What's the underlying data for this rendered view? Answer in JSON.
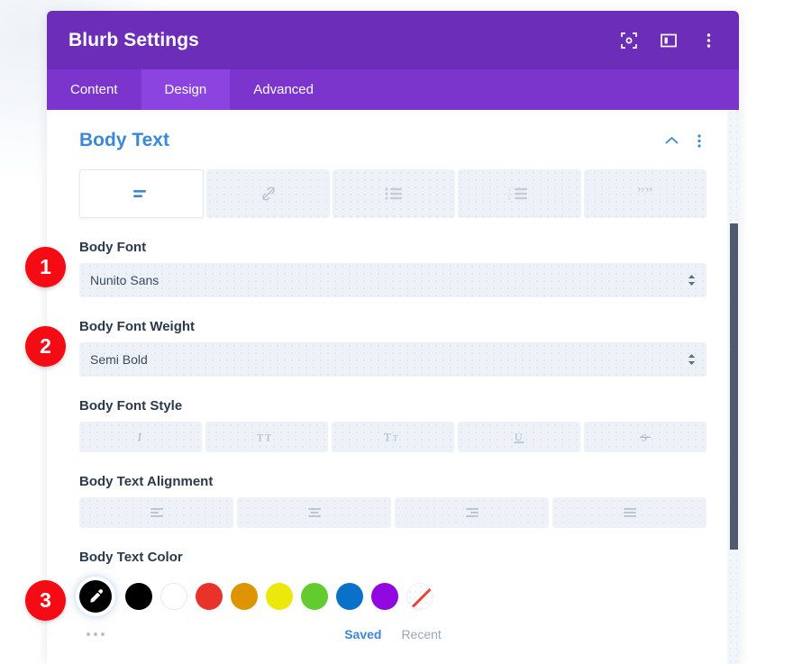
{
  "window": {
    "title": "Blurb Settings",
    "header_icons": [
      {
        "name": "fullscreen-icon",
        "label": "Expand"
      },
      {
        "name": "layout-panel-icon",
        "label": "Dock Panel"
      },
      {
        "name": "more-vertical-icon",
        "label": "More Options"
      }
    ],
    "accent_purple": "#6c2eb9",
    "tabbar_purple": "#7b35cc",
    "active_tab_purple": "#8c44e0"
  },
  "tabs": [
    {
      "label": "Content",
      "active": false
    },
    {
      "label": "Design",
      "active": true
    },
    {
      "label": "Advanced",
      "active": false
    }
  ],
  "section": {
    "title": "Body Text",
    "title_color": "#3b88d8",
    "collapse_icon": "chevron-up-icon",
    "menu_icon": "more-vertical-icon"
  },
  "mode_tabs": [
    {
      "name": "paragraph-text-icon",
      "label": "Text",
      "active": true
    },
    {
      "name": "link-icon",
      "label": "Link",
      "active": false
    },
    {
      "name": "unordered-list-icon",
      "label": "Unordered List",
      "active": false
    },
    {
      "name": "ordered-list-icon",
      "label": "Ordered List",
      "active": false
    },
    {
      "name": "blockquote-icon",
      "label": "Quote",
      "active": false
    }
  ],
  "fields": {
    "body_font": {
      "label": "Body Font",
      "value": "Nunito Sans"
    },
    "body_font_weight": {
      "label": "Body Font Weight",
      "value": "Semi Bold"
    },
    "body_font_style": {
      "label": "Body Font Style",
      "options": [
        {
          "name": "italic-icon",
          "glyph": "I",
          "label": "Italic"
        },
        {
          "name": "uppercase-icon",
          "glyph": "TT",
          "label": "Uppercase"
        },
        {
          "name": "capitalize-icon",
          "glyph": "Tᴛ",
          "label": "Capitalize"
        },
        {
          "name": "underline-icon",
          "glyph": "U",
          "label": "Underline"
        },
        {
          "name": "strikethrough-icon",
          "glyph": "S",
          "label": "Strikethrough"
        }
      ]
    },
    "body_text_alignment": {
      "label": "Body Text Alignment",
      "options": [
        {
          "name": "align-left-icon",
          "label": "Left"
        },
        {
          "name": "align-center-icon",
          "label": "Center"
        },
        {
          "name": "align-right-icon",
          "label": "Right"
        },
        {
          "name": "align-justify-icon",
          "label": "Justify"
        }
      ]
    },
    "body_text_color": {
      "label": "Body Text Color",
      "picker": {
        "name": "eyedropper-icon",
        "label": "Color Picker",
        "selected": true
      },
      "swatches": [
        {
          "name": "swatch-black",
          "color": "#000000"
        },
        {
          "name": "swatch-white",
          "color": "#ffffff"
        },
        {
          "name": "swatch-red",
          "color": "#e8322a"
        },
        {
          "name": "swatch-orange",
          "color": "#dd9400"
        },
        {
          "name": "swatch-yellow",
          "color": "#ede80c"
        },
        {
          "name": "swatch-green",
          "color": "#62cc2e"
        },
        {
          "name": "swatch-blue",
          "color": "#0a71c8"
        },
        {
          "name": "swatch-purple",
          "color": "#9108e0"
        },
        {
          "name": "swatch-none",
          "color": "transparent"
        }
      ],
      "more_label": "More Colors",
      "saved_label": "Saved",
      "recent_label": "Recent"
    }
  },
  "badges": [
    {
      "number": "1",
      "color": "#f50b13"
    },
    {
      "number": "2",
      "color": "#f50b13"
    },
    {
      "number": "3",
      "color": "#f50b13"
    }
  ],
  "scrollbar": {
    "name": "vertical-scrollbar",
    "thumb_color": "#4f5a6e"
  }
}
